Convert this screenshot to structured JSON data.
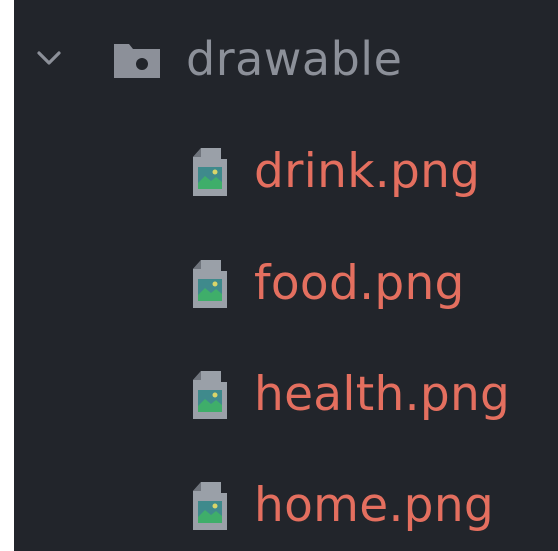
{
  "tree": {
    "folder": {
      "name": "drawable",
      "expanded": true,
      "icon": "folder-icon",
      "chevron_icon": "chevron-down-icon",
      "label_color": "#8c9099"
    },
    "files": [
      {
        "name": "drink.png",
        "icon": "image-file-icon"
      },
      {
        "name": "food.png",
        "icon": "image-file-icon"
      },
      {
        "name": "health.png",
        "icon": "image-file-icon"
      },
      {
        "name": "home.png",
        "icon": "image-file-icon"
      }
    ],
    "file_label_color": "#e46f5f",
    "background_color": "#22252b"
  }
}
